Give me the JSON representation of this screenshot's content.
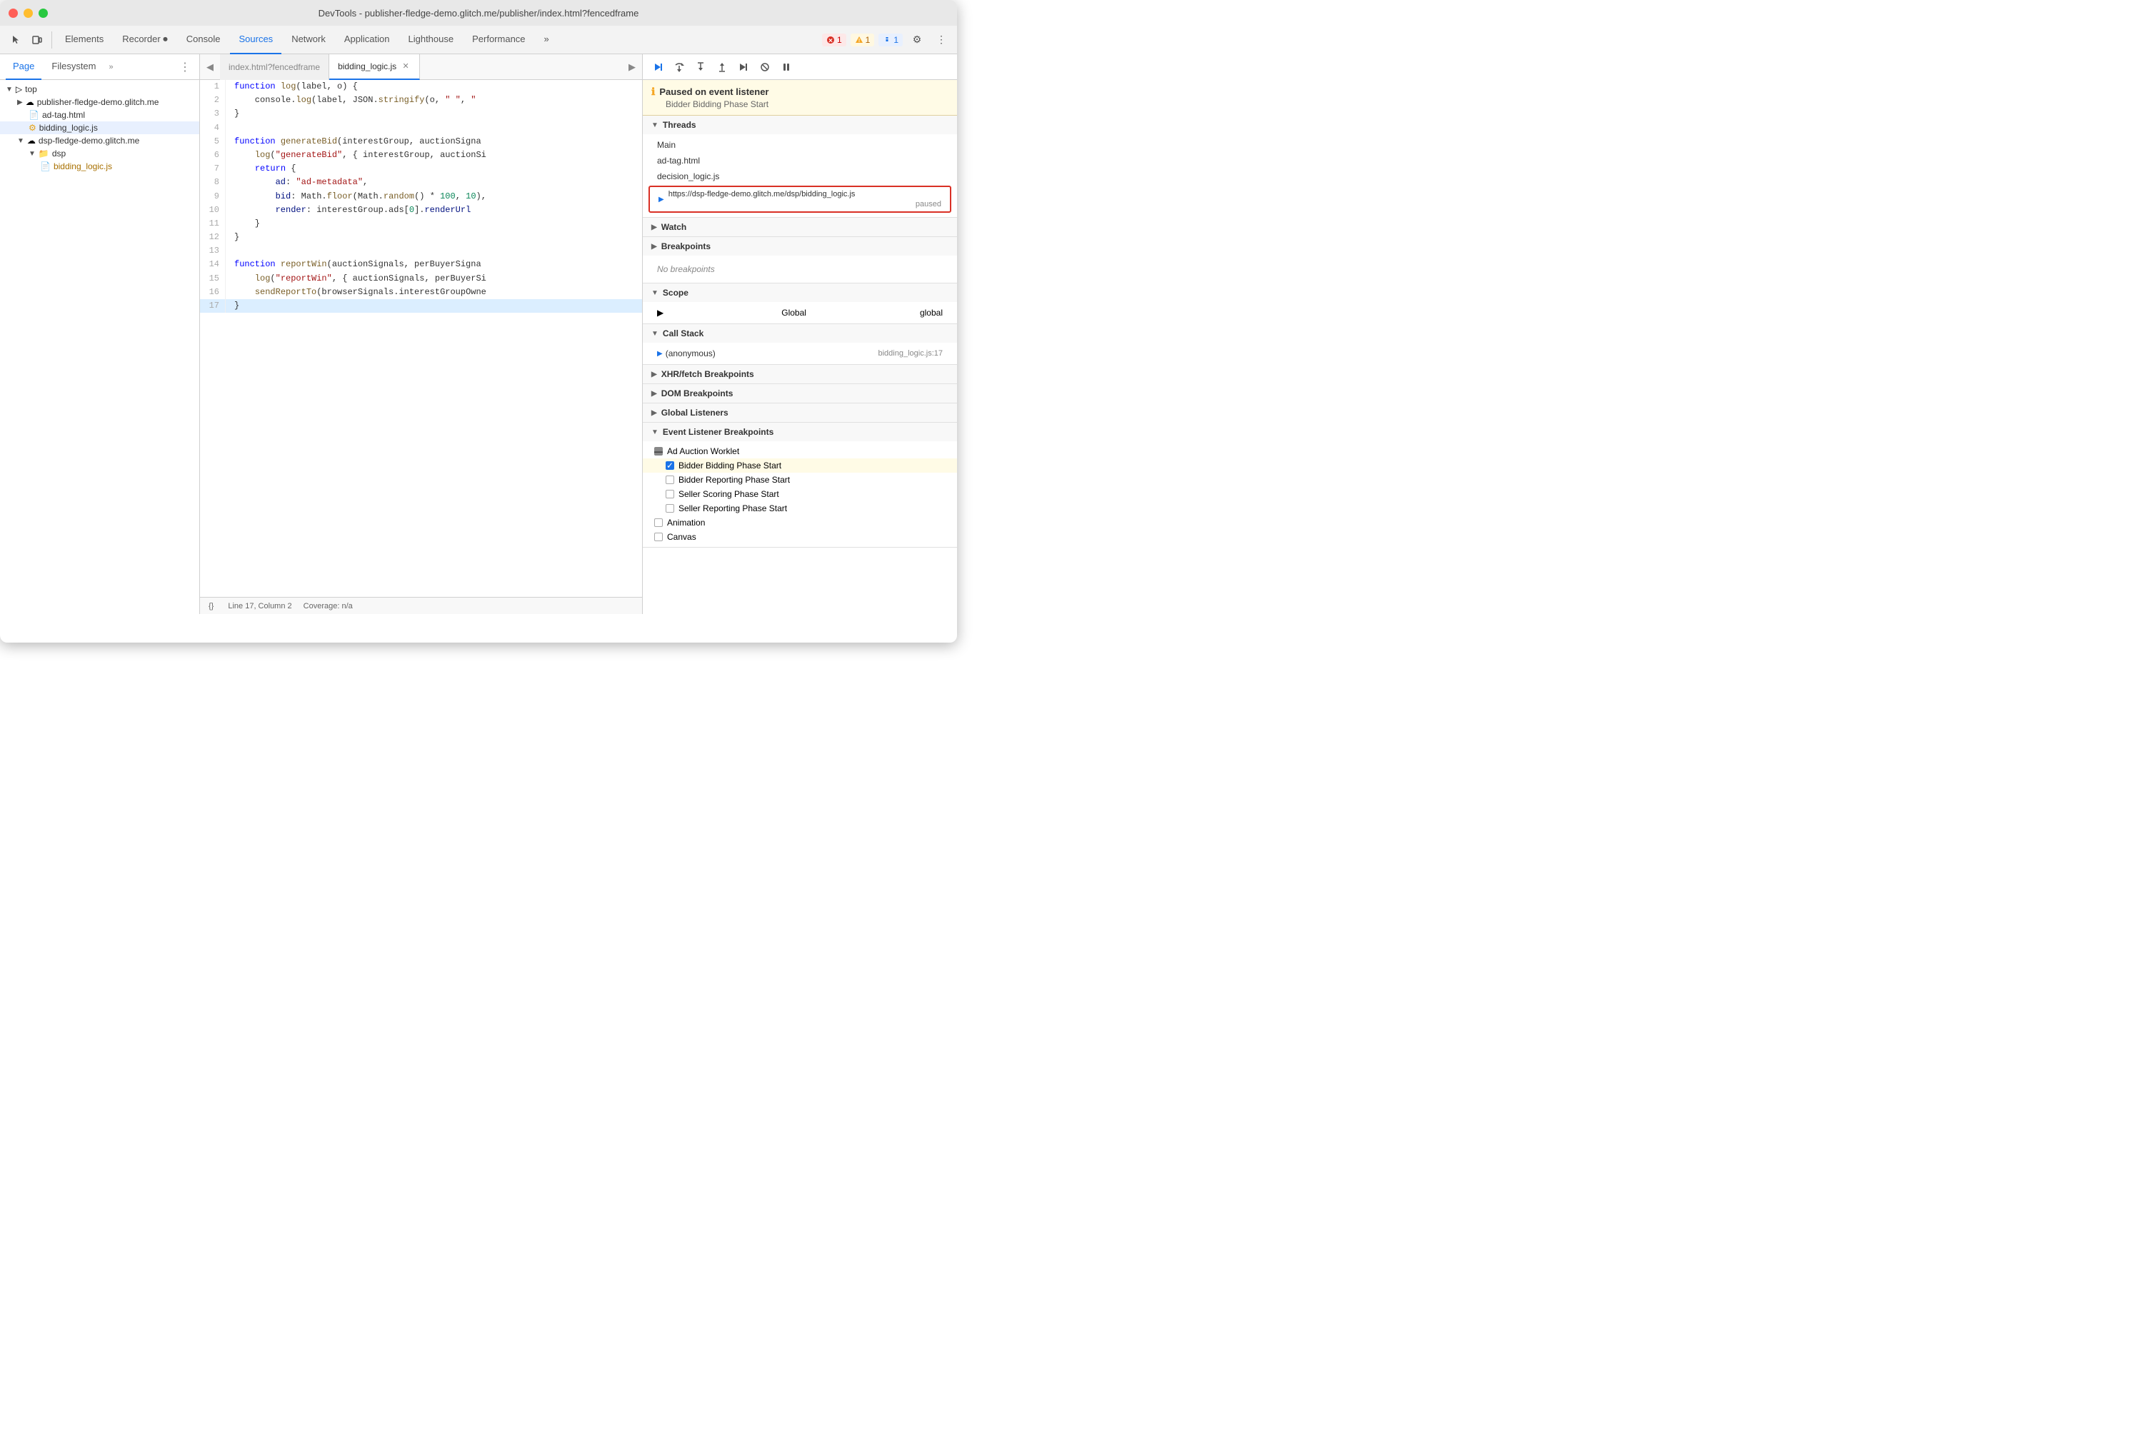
{
  "titlebar": {
    "title": "DevTools - publisher-fledge-demo.glitch.me/publisher/index.html?fencedframe"
  },
  "toolbar": {
    "tabs": [
      {
        "label": "Elements",
        "active": false
      },
      {
        "label": "Recorder ⏺",
        "active": false
      },
      {
        "label": "Console",
        "active": false
      },
      {
        "label": "Sources",
        "active": true
      },
      {
        "label": "Network",
        "active": false
      },
      {
        "label": "Application",
        "active": false
      },
      {
        "label": "Lighthouse",
        "active": false
      },
      {
        "label": "Performance",
        "active": false
      },
      {
        "label": "»",
        "active": false
      }
    ],
    "badges": {
      "error": "1",
      "warn": "1",
      "info": "1"
    }
  },
  "left_panel": {
    "tabs": [
      "Page",
      "Filesystem",
      "»"
    ],
    "active_tab": "Page",
    "tree": [
      {
        "id": "top",
        "label": "top",
        "type": "root",
        "indent": 0,
        "open": true
      },
      {
        "id": "publisher",
        "label": "publisher-fledge-demo.glitch.me",
        "type": "domain",
        "indent": 1,
        "open": false
      },
      {
        "id": "adtag",
        "label": "ad-tag.html",
        "type": "file",
        "indent": 1
      },
      {
        "id": "bidding",
        "label": "bidding_logic.js",
        "type": "file-js",
        "indent": 1,
        "selected": true,
        "open": true
      },
      {
        "id": "dsp",
        "label": "dsp-fledge-demo.glitch.me",
        "type": "domain",
        "indent": 1,
        "open": true
      },
      {
        "id": "dsp-folder",
        "label": "dsp",
        "type": "folder",
        "indent": 2,
        "open": true
      },
      {
        "id": "bidding-js",
        "label": "bidding_logic.js",
        "type": "file-js",
        "indent": 3
      }
    ]
  },
  "editor": {
    "tabs": [
      {
        "label": "index.html?fencedframe",
        "active": false
      },
      {
        "label": "bidding_logic.js",
        "active": true,
        "closeable": true
      }
    ],
    "lines": [
      {
        "num": 1,
        "code": "function log(label, o) {"
      },
      {
        "num": 2,
        "code": "    console.log(label, JSON.stringify(o, \" \", \""
      },
      {
        "num": 3,
        "code": "}"
      },
      {
        "num": 4,
        "code": ""
      },
      {
        "num": 5,
        "code": "function generateBid(interestGroup, auctionSigna"
      },
      {
        "num": 6,
        "code": "    log(\"generateBid\", { interestGroup, auctionSi"
      },
      {
        "num": 7,
        "code": "    return {"
      },
      {
        "num": 8,
        "code": "        ad: \"ad-metadata\","
      },
      {
        "num": 9,
        "code": "        bid: Math.floor(Math.random() * 100, 10),"
      },
      {
        "num": 10,
        "code": "        render: interestGroup.ads[0].renderUrl"
      },
      {
        "num": 11,
        "code": "    }"
      },
      {
        "num": 12,
        "code": "}"
      },
      {
        "num": 13,
        "code": ""
      },
      {
        "num": 14,
        "code": "function reportWin(auctionSignals, perBuyerSigna"
      },
      {
        "num": 15,
        "code": "    log(\"reportWin\", { auctionSignals, perBuyerSi"
      },
      {
        "num": 16,
        "code": "    sendReportTo(browserSignals.interestGroupOwne"
      },
      {
        "num": 17,
        "code": "}",
        "highlighted": true
      }
    ],
    "statusbar": {
      "icon": "{}",
      "position": "Line 17, Column 2",
      "coverage": "Coverage: n/a"
    }
  },
  "debugger": {
    "controls": [
      "resume",
      "step-over",
      "step-into",
      "step-out",
      "step",
      "deactivate",
      "pause-on-exceptions"
    ],
    "paused": {
      "title": "Paused on event listener",
      "subtitle": "Bidder Bidding Phase Start"
    },
    "threads": {
      "label": "Threads",
      "items": [
        {
          "label": "Main",
          "active": false
        },
        {
          "label": "ad-tag.html",
          "active": false
        },
        {
          "label": "decision_logic.js",
          "active": false
        },
        {
          "label": "https://dsp-fledge-demo.glitch.me/dsp/bidding_logic.js",
          "active": true,
          "paused": true,
          "highlighted": true
        }
      ]
    },
    "watch": {
      "label": "Watch"
    },
    "breakpoints": {
      "label": "Breakpoints",
      "empty": "No breakpoints"
    },
    "scope": {
      "label": "Scope",
      "items": [
        {
          "label": "Global",
          "value": "global"
        }
      ]
    },
    "call_stack": {
      "label": "Call Stack",
      "items": [
        {
          "label": "(anonymous)",
          "value": "bidding_logic.js:17",
          "active": true
        }
      ]
    },
    "xhr_breakpoints": {
      "label": "XHR/fetch Breakpoints"
    },
    "dom_breakpoints": {
      "label": "DOM Breakpoints"
    },
    "global_listeners": {
      "label": "Global Listeners"
    },
    "event_listener_breakpoints": {
      "label": "Event Listener Breakpoints",
      "groups": [
        {
          "label": "Ad Auction Worklet",
          "open": true,
          "items": [
            {
              "label": "Bidder Bidding Phase Start",
              "checked": true,
              "highlighted": true
            },
            {
              "label": "Bidder Reporting Phase Start",
              "checked": false
            },
            {
              "label": "Seller Scoring Phase Start",
              "checked": false
            },
            {
              "label": "Seller Reporting Phase Start",
              "checked": false
            }
          ]
        },
        {
          "label": "Animation",
          "open": false,
          "items": []
        },
        {
          "label": "Canvas",
          "open": false,
          "items": []
        }
      ]
    }
  }
}
